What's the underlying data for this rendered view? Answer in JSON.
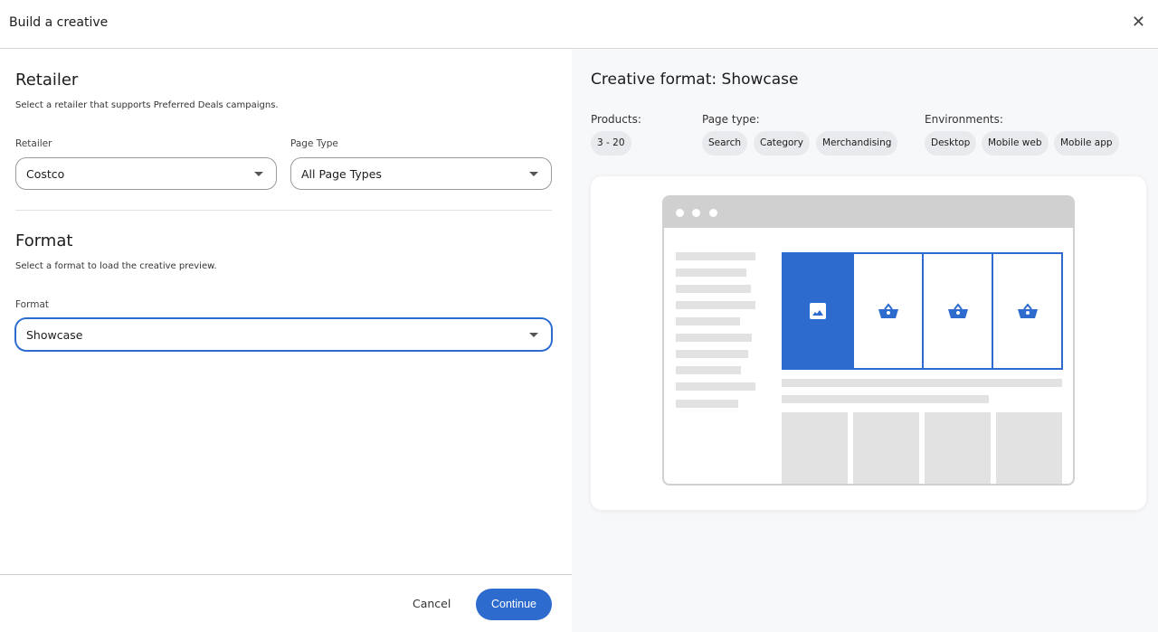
{
  "header": {
    "title": "Build a creative",
    "close_icon": "close-icon"
  },
  "retailer_section": {
    "title": "Retailer",
    "subtitle": "Select a retailer that supports Preferred Deals campaigns.",
    "retailer_label": "Retailer",
    "retailer_value": "Costco",
    "page_type_label": "Page Type",
    "page_type_value": "All Page Types"
  },
  "format_section": {
    "title": "Format",
    "subtitle": "Select a format to load the creative preview.",
    "format_label": "Format",
    "format_value": "Showcase"
  },
  "footer": {
    "cancel": "Cancel",
    "continue": "Continue"
  },
  "preview": {
    "title": "Creative format: Showcase",
    "products_label": "Products:",
    "products": [
      "3 - 20"
    ],
    "page_type_label": "Page type:",
    "page_types": [
      "Search",
      "Category",
      "Merchandising"
    ],
    "environments_label": "Environments:",
    "environments": [
      "Desktop",
      "Mobile web",
      "Mobile app"
    ]
  },
  "colors": {
    "accent": "#2d6bcf"
  }
}
